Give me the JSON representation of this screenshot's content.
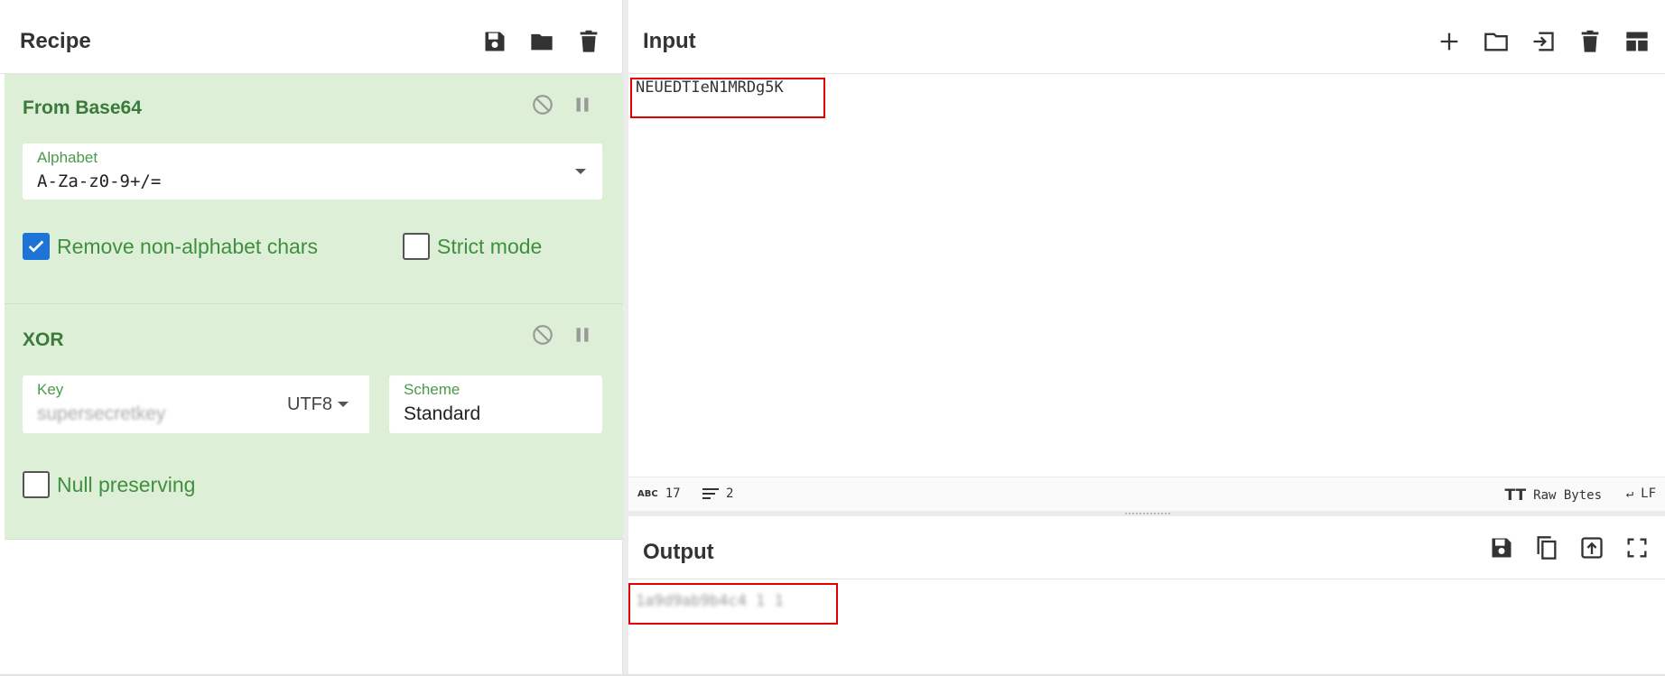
{
  "recipe": {
    "title": "Recipe",
    "icons": [
      "save-icon",
      "folder-icon",
      "trash-icon"
    ],
    "operations": [
      {
        "name": "From Base64",
        "alphabet_label": "Alphabet",
        "alphabet_value": "A-Za-z0-9+/=",
        "remove_non_alphabet_label": "Remove non-alphabet chars",
        "remove_non_alphabet_checked": true,
        "strict_mode_label": "Strict mode",
        "strict_mode_checked": false
      },
      {
        "name": "XOR",
        "key_label": "Key",
        "key_value": "supersecretkey",
        "key_encoding": "UTF8",
        "scheme_label": "Scheme",
        "scheme_value": "Standard",
        "null_preserving_label": "Null preserving",
        "null_preserving_checked": false
      }
    ]
  },
  "input": {
    "title": "Input",
    "icons": [
      "plus-icon",
      "folder-icon",
      "sign-in-icon",
      "trash-icon",
      "layout-icon"
    ],
    "text": "NEUEDTIeN1MRDg5K",
    "status": {
      "length_label": "ABC",
      "length": "17",
      "lines": "2",
      "format_label": "Raw Bytes",
      "eol_label": "LF"
    }
  },
  "output": {
    "title": "Output",
    "icons": [
      "save-icon",
      "copy-icon",
      "upload-icon",
      "fullscreen-icon"
    ],
    "text": "1a9d9ab9b4c4 1 1"
  },
  "colors": {
    "operation_bg": "#deefd8",
    "operation_title": "#3a7a3a",
    "checkbox_checked": "#1e73d6",
    "highlight_red": "#e00000"
  }
}
